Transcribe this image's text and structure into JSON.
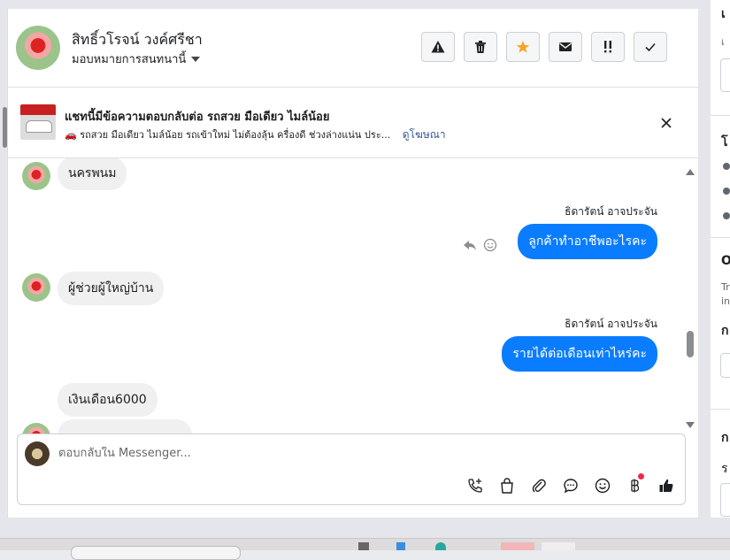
{
  "header": {
    "contact_name": "สิทธิ์วโรจน์ วงค์ศรีชา",
    "assign_label": "มอบหมายการสนทนานี้",
    "buttons": [
      {
        "name": "warning-button",
        "icon": "warning-icon"
      },
      {
        "name": "delete-button",
        "icon": "trash-icon"
      },
      {
        "name": "star-button",
        "icon": "star-icon",
        "color": "#f5a623"
      },
      {
        "name": "mark-unread-button",
        "icon": "envelope-icon"
      },
      {
        "name": "follow-up-button",
        "icon": "double-exclamation-icon"
      },
      {
        "name": "mark-done-button",
        "icon": "check-icon"
      }
    ]
  },
  "ad_banner": {
    "title": "แชทนี้มีข้อความตอบกลับต่อ รถสวย มือเดียว ไมล์น้อย",
    "subtitle": "🚗 รถสวย มือเดียว ไมล์น้อย รถเข้าใหม่ ไม่ต้องลุ้น ครื่องดี ช่วงล่างแน่น ประ...",
    "view_ad_link": "ดูโฆษณา"
  },
  "messages": [
    {
      "direction": "in",
      "text": "นครพนม"
    },
    {
      "direction": "out",
      "sender": "ธิดารัตน์ อาจประจัน",
      "text": "ลูกค้าทำอาชีพอะไรคะ"
    },
    {
      "direction": "in",
      "text": "ผู้ช่วยผู้ใหญ่บ้าน"
    },
    {
      "direction": "out",
      "sender": "ธิดารัตน์ อาจประจัน",
      "text": "รายได้ต่อเดือนเท่าไหร่คะ"
    },
    {
      "direction": "in",
      "text": "เงินเดือน6000"
    },
    {
      "direction": "in",
      "text": "..."
    }
  ],
  "composer": {
    "placeholder": "ตอบกลับใน Messenger..."
  },
  "colors": {
    "outgoing_bubble": "#0a7cff",
    "incoming_bubble": "#f0f0f0",
    "link": "#385898"
  }
}
